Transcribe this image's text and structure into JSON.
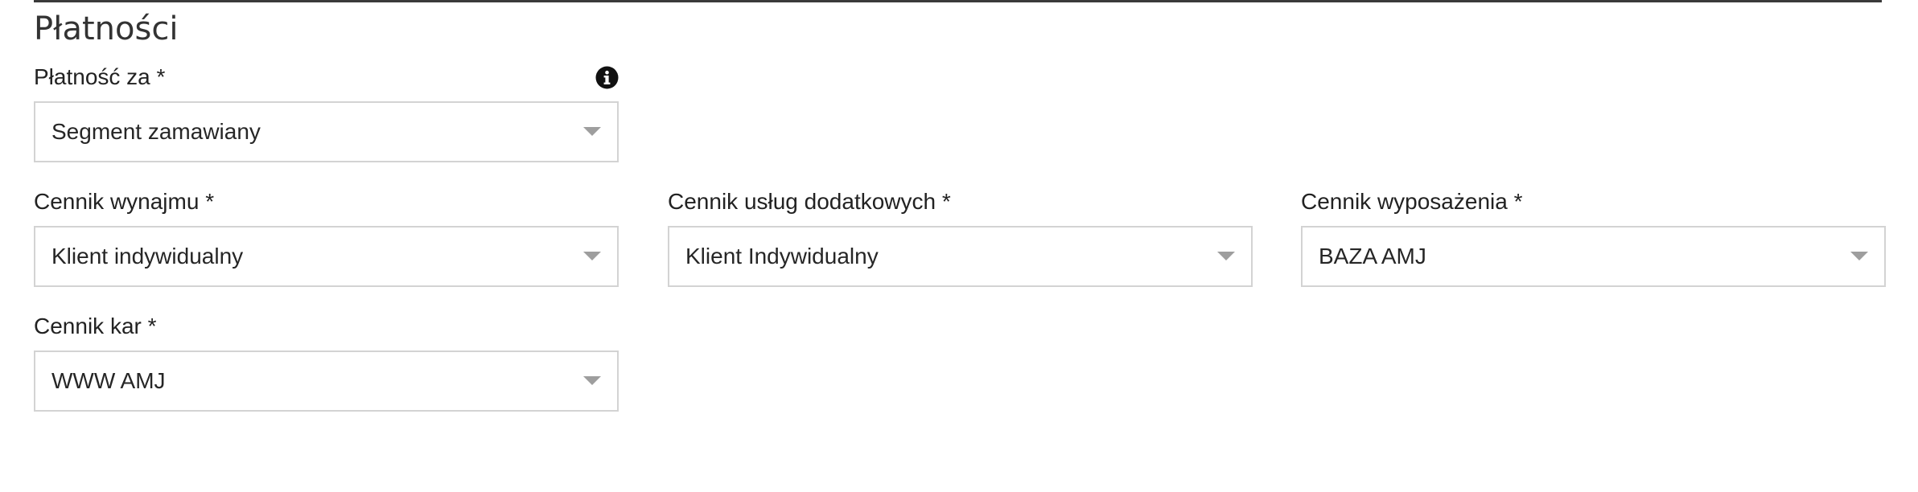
{
  "section": {
    "title": "Płatności"
  },
  "fields": {
    "payment_for": {
      "label": "Płatność za *",
      "value": "Segment zamawiany"
    },
    "rental_pricelist": {
      "label": "Cennik wynajmu *",
      "value": "Klient indywidualny"
    },
    "extra_services_pricelist": {
      "label": "Cennik usług dodatkowych *",
      "value": "Klient Indywidualny"
    },
    "equipment_pricelist": {
      "label": "Cennik wyposażenia *",
      "value": "BAZA AMJ"
    },
    "penalty_pricelist": {
      "label": "Cennik kar *",
      "value": "WWW AMJ"
    }
  },
  "icons": {
    "info": "info-icon",
    "dropdown": "caret-down-icon"
  },
  "colors": {
    "border": "#d3d3d3",
    "caret": "#9e9e9e",
    "text": "#212121"
  }
}
